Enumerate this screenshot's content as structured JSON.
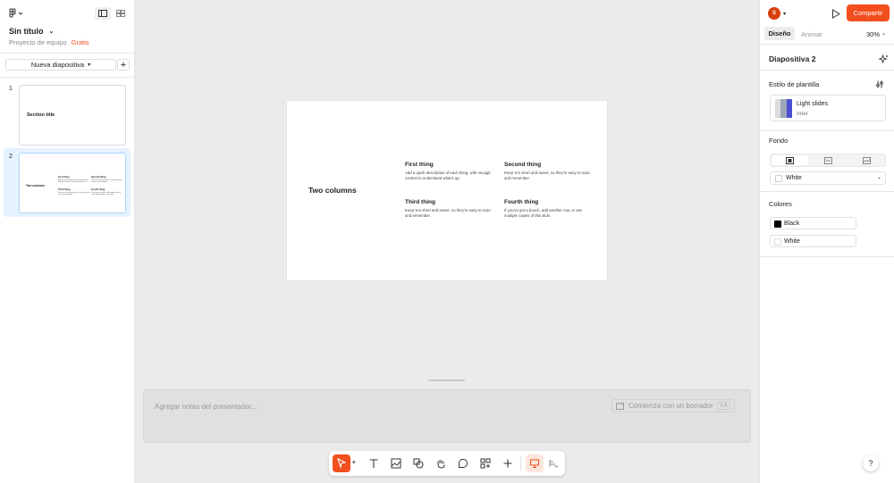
{
  "left_panel": {
    "file_title": "Sin título",
    "team": "Proyecto de equipo",
    "plan_badge": "Gratis",
    "new_slide_label": "Nueva diapositiva",
    "slides": [
      {
        "number": "1",
        "title": "Section title"
      },
      {
        "number": "2",
        "title": "Two columns",
        "items": [
          {
            "heading": "First thing",
            "body": "Add a quick description of each thing, with enough context to understand what's up."
          },
          {
            "heading": "Second thing",
            "body": "Keep 'em short and sweet, so they're easy to scan and remember."
          },
          {
            "heading": "Third thing",
            "body": "Keep 'em short and sweet, so they're easy to scan and remember."
          },
          {
            "heading": "Fourth thing",
            "body": "If you've got a bunch, add another row, or use multiple copies of this slide."
          }
        ]
      }
    ]
  },
  "canvas": {
    "slide": {
      "title": "Two columns",
      "items": [
        {
          "heading": "First thing",
          "body": "Add a quick description of each thing, with enough context to understand what's up."
        },
        {
          "heading": "Second thing",
          "body": "Keep 'em short and sweet, so they're easy to scan and remember."
        },
        {
          "heading": "Third thing",
          "body": "Keep 'em short and sweet, so they're easy to scan and remember."
        },
        {
          "heading": "Fourth thing",
          "body": "If you've got a bunch, add another row, or use multiple copies of this slide."
        }
      ]
    },
    "notes_placeholder": "Agregar notas del presentador...",
    "draft_button": "Comienza con un borrador",
    "draft_shortcut": "⇧A"
  },
  "toolbar": {
    "tools": [
      "move-tool",
      "text-tool",
      "image-tool",
      "shapes-tool",
      "stamp-tool",
      "comment-tool",
      "widgets-tool",
      "add-tool"
    ]
  },
  "right_panel": {
    "avatar_initial": "S",
    "share_label": "Compartir",
    "tabs": {
      "design": "Diseño",
      "animate": "Animar"
    },
    "zoom": "30%",
    "slide_name": "Diapositiva 2",
    "template_style_label": "Estilo de plantilla",
    "template_name": "Light slides",
    "template_font": "Inter",
    "background_label": "Fondo",
    "background_value": "White",
    "colors_label": "Colores",
    "colors": [
      {
        "name": "Black",
        "hex": "#000000"
      },
      {
        "name": "White",
        "hex": "#ffffff"
      }
    ],
    "help": "?"
  },
  "colors": {
    "accent": "#f24e1e",
    "selected_slide_bg": "#e5f2ff",
    "selected_slide_border": "#aed4fb"
  }
}
